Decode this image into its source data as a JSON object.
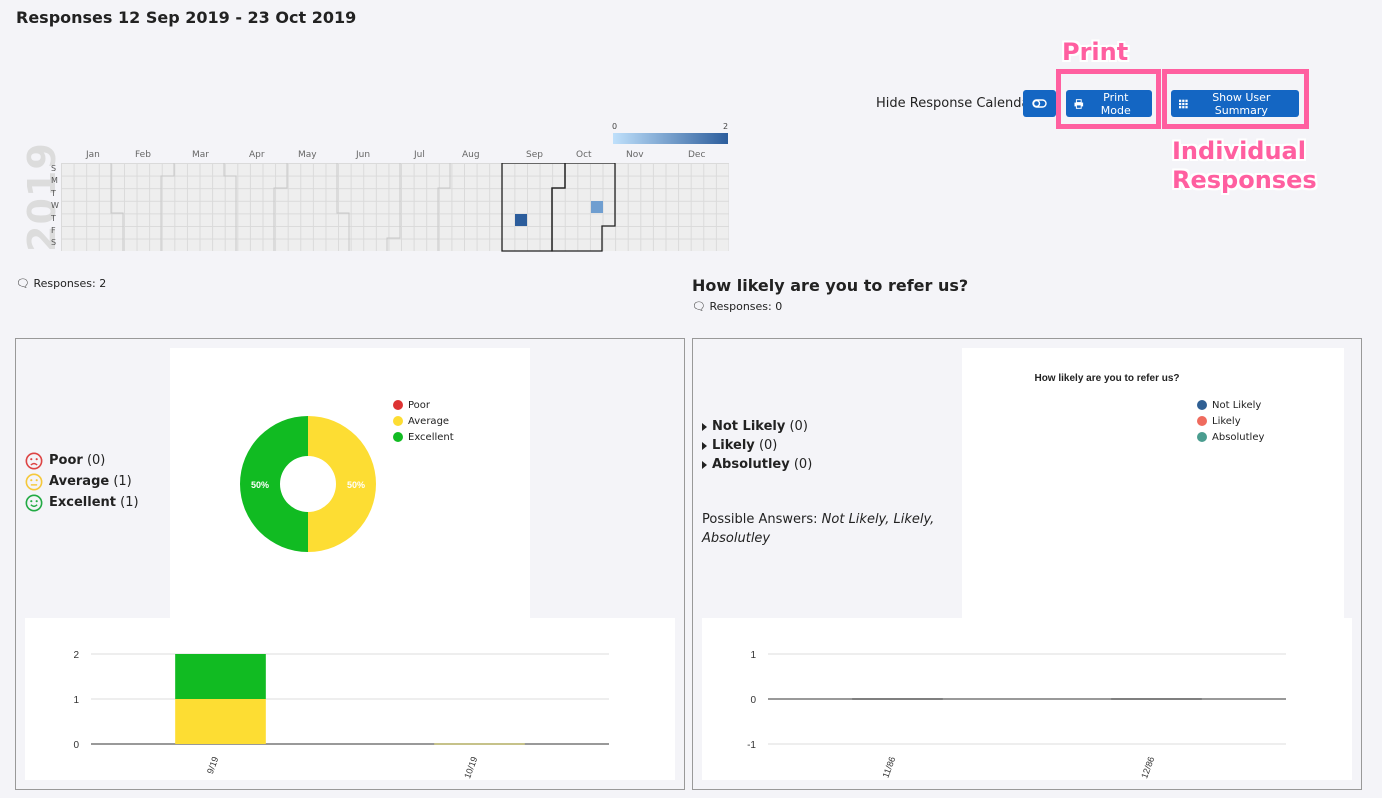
{
  "page": {
    "title": "Responses 12 Sep 2019 - 23 Oct 2019",
    "toggle_label": "Hide Response Calendar",
    "print_label": "Print Mode",
    "summary_label": "Show User Summary"
  },
  "annotations": {
    "print": "Print",
    "individual": "Individual Responses"
  },
  "colors": {
    "primary": "#1466c3",
    "highlight": "#ff5fa0",
    "poor": "#dd3333",
    "average": "#fddd33",
    "excellent": "#11bb22",
    "not_likely": "#2f5f93",
    "likely": "#ef6b5e",
    "absolutley": "#4a9d8f"
  },
  "calendar": {
    "year": "2019",
    "days": [
      "S",
      "M",
      "T",
      "W",
      "T",
      "F",
      "S"
    ],
    "months": [
      "Jan",
      "Feb",
      "Mar",
      "Apr",
      "May",
      "Jun",
      "Jul",
      "Aug",
      "Sep",
      "Oct",
      "Nov",
      "Dec"
    ],
    "legend_min": "0",
    "legend_max": "2"
  },
  "left": {
    "responses": "Responses: 2",
    "answers": [
      {
        "label": "Poor",
        "count": "(0)",
        "icon": "frown-face-icon"
      },
      {
        "label": "Average",
        "count": "(1)",
        "icon": "neutral-face-icon"
      },
      {
        "label": "Excellent",
        "count": "(1)",
        "icon": "smile-face-icon"
      }
    ],
    "legend": [
      "Poor",
      "Average",
      "Excellent"
    ]
  },
  "right": {
    "question": "How likely are you to refer us?",
    "responses": "Responses: 0",
    "answers": [
      {
        "label": "Not Likely",
        "count": "(0)"
      },
      {
        "label": "Likely",
        "count": "(0)"
      },
      {
        "label": "Absolutley",
        "count": "(0)"
      }
    ],
    "possible_label": "Possible Answers:",
    "possible_values": "Not Likely, Likely, Absolutley",
    "chart_title": "How likely are you to refer us?",
    "legend": [
      "Not Likely",
      "Likely",
      "Absolutley"
    ]
  },
  "chart_data": [
    {
      "type": "pie",
      "categories": [
        "Poor",
        "Average",
        "Excellent"
      ],
      "values": [
        0,
        1,
        1
      ],
      "data_labels": [
        "50%",
        "50%"
      ],
      "legend_position": "top-right"
    },
    {
      "type": "bar",
      "stacked": true,
      "categories": [
        "9/19",
        "10/19"
      ],
      "series": [
        {
          "name": "Average",
          "values": [
            1,
            0
          ]
        },
        {
          "name": "Excellent",
          "values": [
            1,
            0
          ]
        }
      ],
      "y_ticks": [
        "0",
        "1",
        "2"
      ],
      "ylim": [
        0,
        2
      ],
      "grid": true
    },
    {
      "type": "pie",
      "title": "How likely are you to refer us?",
      "categories": [
        "Not Likely",
        "Likely",
        "Absolutley"
      ],
      "values": [
        0,
        0,
        0
      ],
      "legend_position": "top-right"
    },
    {
      "type": "bar",
      "categories": [
        "11/86",
        "12/86"
      ],
      "values": [
        0,
        0
      ],
      "y_ticks": [
        "-1",
        "0",
        "1"
      ],
      "ylim": [
        -1,
        1
      ],
      "grid": true
    }
  ]
}
